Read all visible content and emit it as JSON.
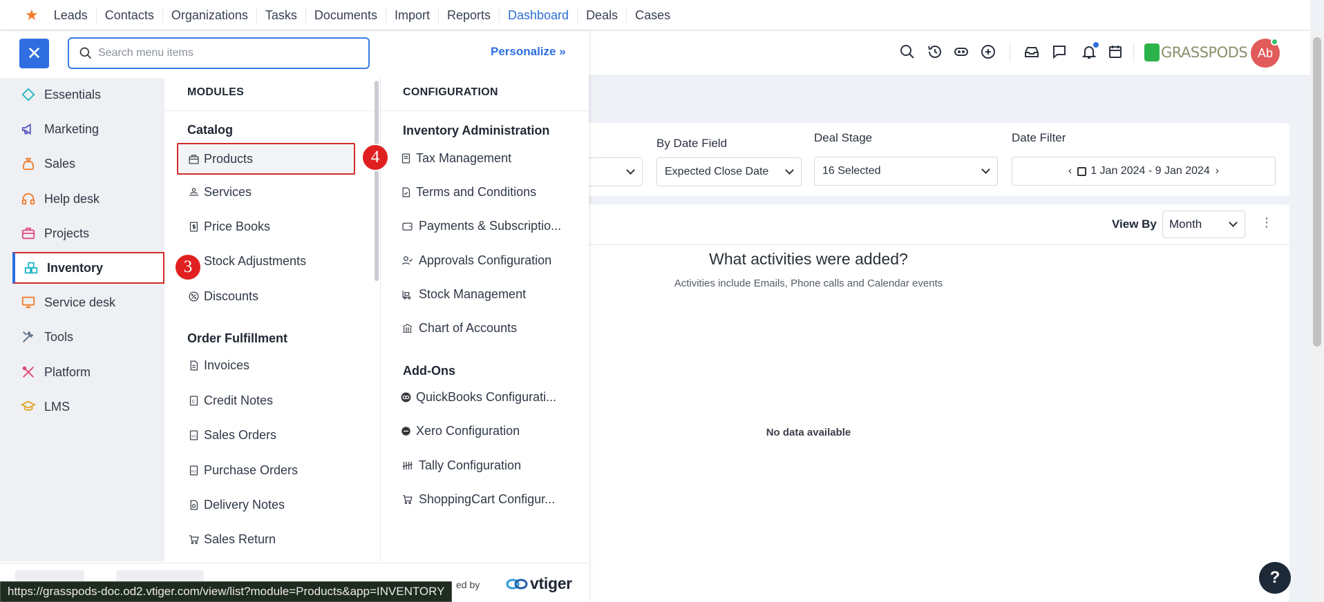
{
  "topnav": {
    "items": [
      "Leads",
      "Contacts",
      "Organizations",
      "Tasks",
      "Documents",
      "Import",
      "Reports",
      "Dashboard",
      "Deals",
      "Cases"
    ],
    "active": "Dashboard"
  },
  "header": {
    "brand": "GRASSPODS",
    "avatar_initials": "Ab"
  },
  "menu": {
    "search_placeholder": "Search menu items",
    "personalize_label": "Personalize »",
    "apps": [
      {
        "label": "Essentials",
        "icon": "diamond-icon",
        "color": "#1fb5c4"
      },
      {
        "label": "Marketing",
        "icon": "megaphone-icon",
        "color": "#5a54c4"
      },
      {
        "label": "Sales",
        "icon": "money-bag-icon",
        "color": "#f07c2b"
      },
      {
        "label": "Help desk",
        "icon": "headset-icon",
        "color": "#f07c2b"
      },
      {
        "label": "Projects",
        "icon": "briefcase-icon",
        "color": "#e2457a"
      },
      {
        "label": "Inventory",
        "icon": "boxes-icon",
        "color": "#1fb5c4"
      },
      {
        "label": "Service desk",
        "icon": "monitor-icon",
        "color": "#f07c2b"
      },
      {
        "label": "Tools",
        "icon": "tools-icon",
        "color": "#5a6b85"
      },
      {
        "label": "Platform",
        "icon": "wrench-icon",
        "color": "#e2457a"
      },
      {
        "label": "LMS",
        "icon": "graduation-cap-icon",
        "color": "#e2a52b"
      }
    ],
    "modules_heading": "MODULES",
    "configuration_heading": "CONFIGURATION",
    "catalog": {
      "title": "Catalog",
      "items": [
        "Products",
        "Services",
        "Price Books",
        "Stock Adjustments",
        "Discounts"
      ]
    },
    "order_fulfillment": {
      "title": "Order Fulfillment",
      "items": [
        "Invoices",
        "Credit Notes",
        "Sales Orders",
        "Purchase Orders",
        "Delivery Notes",
        "Sales Return"
      ]
    },
    "inventory_admin": {
      "title": "Inventory Administration",
      "items": [
        "Tax Management",
        "Terms and Conditions",
        "Payments & Subscriptio...",
        "Approvals Configuration",
        "Stock Management",
        "Chart of Accounts"
      ]
    },
    "addons": {
      "title": "Add-Ons",
      "items": [
        "QuickBooks Configurati...",
        "Xero Configuration",
        "Tally Configuration",
        "ShoppingCart Configur..."
      ]
    },
    "powered_by": "ed by",
    "vtiger": "vtiger"
  },
  "steps": {
    "inventory": "3",
    "products": "4"
  },
  "filters": {
    "by_date_field_label": "By Date Field",
    "by_date_field_value": "Expected Close Date",
    "deal_stage_label": "Deal Stage",
    "deal_stage_value": "16 Selected",
    "date_filter_label": "Date Filter",
    "date_filter_value": "1 Jan 2024 - 9 Jan 2024"
  },
  "widget": {
    "view_by_label": "View By",
    "view_by_value": "Month",
    "title": "What activities were added?",
    "subtitle": "Activities include Emails, Phone calls and Calendar events",
    "no_data": "No data available"
  },
  "status_url": "https://grasspods-doc.od2.vtiger.com/view/list?module=Products&app=INVENTORY"
}
